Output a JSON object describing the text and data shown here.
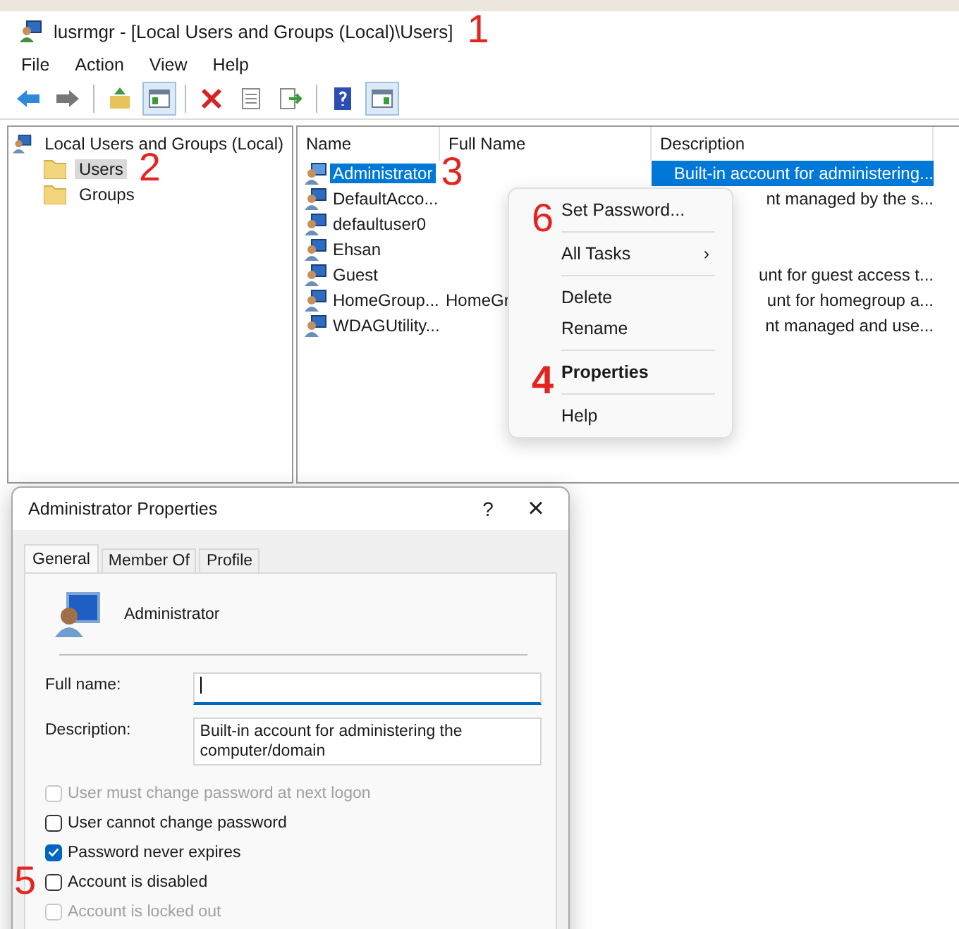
{
  "window": {
    "title": "lusrmgr - [Local Users and Groups (Local)\\Users]",
    "step": "1"
  },
  "menu": [
    "File",
    "Action",
    "View",
    "Help"
  ],
  "toolbar": [
    {
      "kind": "back",
      "pressed": false
    },
    {
      "kind": "forward",
      "pressed": false
    },
    {
      "kind": "separator"
    },
    {
      "kind": "up",
      "pressed": false
    },
    {
      "kind": "tree",
      "pressed": true
    },
    {
      "kind": "separator"
    },
    {
      "kind": "delete",
      "pressed": false
    },
    {
      "kind": "properties",
      "pressed": false
    },
    {
      "kind": "export",
      "pressed": false
    },
    {
      "kind": "separator"
    },
    {
      "kind": "help",
      "pressed": false
    },
    {
      "kind": "pane",
      "pressed": true
    }
  ],
  "tree": {
    "label": "Local Users and Groups (Local)",
    "children": [
      {
        "label": "Users",
        "selected": true,
        "step": "2"
      },
      {
        "label": "Groups",
        "selected": false
      }
    ]
  },
  "list": {
    "columns": [
      "Name",
      "Full Name",
      "Description"
    ],
    "rows": [
      {
        "name": "Administrator",
        "selected": true,
        "step": "3",
        "description": "Built-in account for administering..."
      },
      {
        "name": "DefaultAcco...",
        "selected": false,
        "description": "nt managed by the s..."
      },
      {
        "name": "defaultuser0",
        "selected": false
      },
      {
        "name": "Ehsan",
        "selected": false
      },
      {
        "name": "Guest",
        "selected": false,
        "description": "unt for guest access t..."
      },
      {
        "name": "HomeGroup...",
        "selected": false,
        "full_name": "HomeGr",
        "description": "unt for homegroup a..."
      },
      {
        "name": "WDAGUtility...",
        "selected": false,
        "description": "nt managed and use..."
      }
    ]
  },
  "context_menu": [
    {
      "kind": "item",
      "label": "Set Password...",
      "default": false,
      "step": "6"
    },
    {
      "kind": "separator"
    },
    {
      "kind": "item",
      "label": "All Tasks",
      "default": false,
      "submenu": "›"
    },
    {
      "kind": "separator"
    },
    {
      "kind": "item",
      "label": "Delete",
      "default": false
    },
    {
      "kind": "item",
      "label": "Rename",
      "default": false
    },
    {
      "kind": "separator"
    },
    {
      "kind": "item",
      "label": "Properties",
      "default": true,
      "step": "4"
    },
    {
      "kind": "separator"
    },
    {
      "kind": "item",
      "label": "Help",
      "default": false
    }
  ],
  "dialog": {
    "title": "Administrator Properties",
    "help": "?",
    "close": "×",
    "tabs": [
      {
        "label": "General",
        "selected": true
      },
      {
        "label": "Member Of",
        "selected": false
      },
      {
        "label": "Profile",
        "selected": false
      }
    ],
    "user": "Administrator",
    "fields": [
      {
        "label": "Full name:",
        "focused": true
      },
      {
        "label": "Description:",
        "value": "Built-in account for administering the computer/domain",
        "focused": false
      }
    ],
    "options": [
      {
        "label": "User must change password at next logon",
        "checked": false,
        "disabled": true
      },
      {
        "label": "User cannot change password",
        "checked": false,
        "disabled": false
      },
      {
        "label": "Password never expires",
        "checked": true,
        "disabled": false
      },
      {
        "label": "Account is disabled",
        "checked": false,
        "disabled": false,
        "step": "5"
      },
      {
        "label": "Account is locked out",
        "checked": false,
        "disabled": true
      }
    ]
  }
}
